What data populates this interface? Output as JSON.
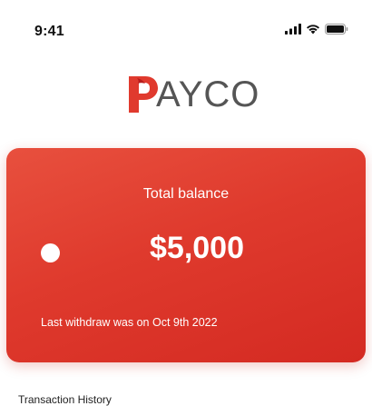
{
  "status_bar": {
    "time": "9:41",
    "icons": [
      "signal-icon",
      "wifi-icon",
      "battery-icon"
    ]
  },
  "logo": {
    "text": "AYCO",
    "brand_color": "#e03a2e"
  },
  "balance_card": {
    "title": "Total balance",
    "amount": "$5,000",
    "note": "Last withdraw was on Oct 9th 2022",
    "gradient": [
      "#e8503e",
      "#d42a22"
    ]
  },
  "section": {
    "title": "Transaction History"
  }
}
